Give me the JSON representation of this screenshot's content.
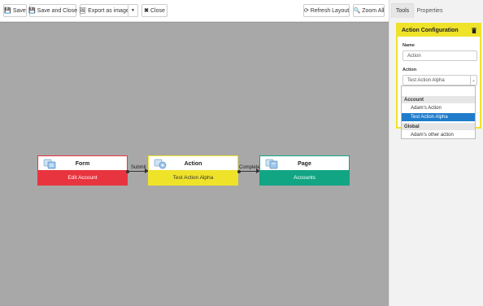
{
  "toolbar": {
    "save": "Save",
    "save_close": "Save and Close",
    "export": "Export as image",
    "close": "Close",
    "refresh": "Refresh Layout",
    "zoom_all": "Zoom All"
  },
  "canvas": {
    "nodes": [
      {
        "title": "Form",
        "subtitle": "Edit Account",
        "color": "#e8343f"
      },
      {
        "title": "Action",
        "subtitle": "Test Action Alpha",
        "color": "#efe32a"
      },
      {
        "title": "Page",
        "subtitle": "Accounts",
        "color": "#12a584"
      }
    ],
    "edges": [
      {
        "label": "Submit"
      },
      {
        "label": "Complete"
      }
    ]
  },
  "panel": {
    "tabs": [
      "Tools",
      "Properties"
    ],
    "config": {
      "title": "Action Configuration",
      "name_label": "Name",
      "name_value": "Action",
      "action_label": "Action",
      "action_value": "Test Action Alpha"
    },
    "dropdown": {
      "groups": [
        {
          "label": "Account",
          "items": [
            "Adam's Action",
            "Test Action Alpha"
          ]
        },
        {
          "label": "Global",
          "items": [
            "Adam's other action"
          ]
        }
      ],
      "selected": "Test Action Alpha"
    }
  }
}
